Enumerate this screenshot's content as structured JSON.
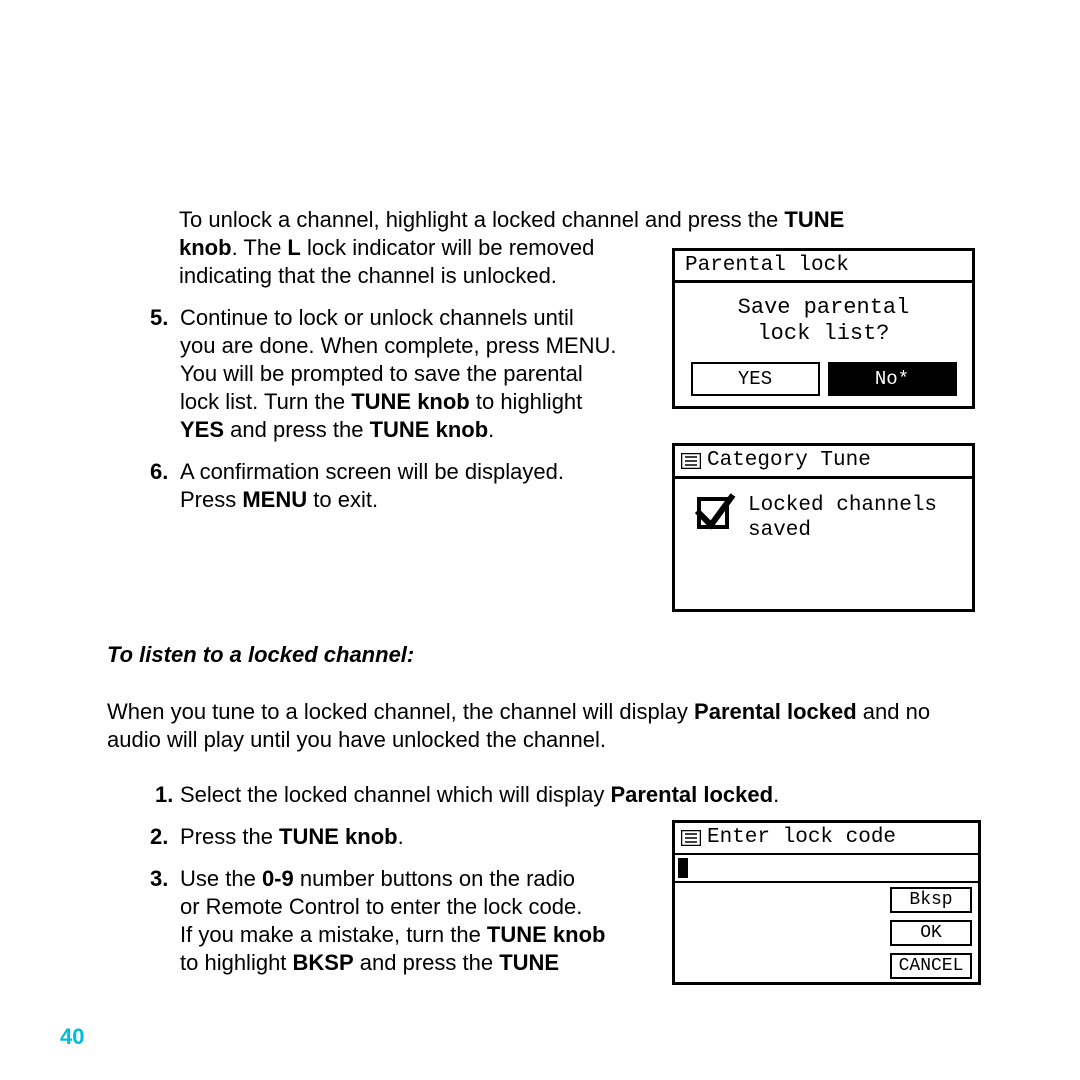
{
  "intro": {
    "line1_a": "To unlock a channel, highlight a locked channel and press the ",
    "line1_b": "TUNE",
    "line2_a": "knob",
    "line2_b": ". The ",
    "line2_c": "L",
    "line2_d": " lock indicator will be removed",
    "line3": "indicating that the channel is unlocked."
  },
  "step5": {
    "num": "5.",
    "l1": "Continue to lock or unlock channels until",
    "l2": "you are done. When complete, press MENU.",
    "l3": "You will be prompted to save the parental",
    "l4_a": "lock list. Turn the ",
    "l4_b": "TUNE knob",
    "l4_c": " to highlight",
    "l5_a": "YES",
    "l5_b": " and press the ",
    "l5_c": "TUNE knob",
    "l5_d": "."
  },
  "step6": {
    "num": "6.",
    "l1": "A confirmation screen will be displayed.",
    "l2_a": "Press ",
    "l2_b": "MENU",
    "l2_c": " to exit."
  },
  "box1": {
    "title": "Parental lock",
    "q1": "Save parental",
    "q2": "lock list?",
    "yes": "YES",
    "no": "No*"
  },
  "box2": {
    "title": "Category Tune",
    "msg1": "Locked channels",
    "msg2": "saved"
  },
  "section2": {
    "heading": "To listen to a locked channel:",
    "p_a": "When you tune to a locked channel, the channel will display ",
    "p_b": "Parental locked",
    "p_c": " and no",
    "p2": "audio will play until you have unlocked the channel."
  },
  "s1": {
    "num": "1.",
    "a": "Select the locked channel which will display ",
    "b": "Parental locked",
    "c": "."
  },
  "s2": {
    "num": "2.",
    "a": "Press the ",
    "b": "TUNE knob",
    "c": "."
  },
  "s3": {
    "num": "3.",
    "l1_a": "Use the ",
    "l1_b": "0-9",
    "l1_c": " number buttons on the radio",
    "l2": "or Remote Control to enter the lock code.",
    "l3_a": "If you make a mistake, turn the ",
    "l3_b": "TUNE knob",
    "l4_a": "to highlight ",
    "l4_b": "BKSP",
    "l4_c": " and press the ",
    "l4_d": "TUNE"
  },
  "box3": {
    "title": "Enter lock code",
    "bksp": "Bksp",
    "ok": "OK",
    "cancel": "CANCEL"
  },
  "page_number": "40"
}
